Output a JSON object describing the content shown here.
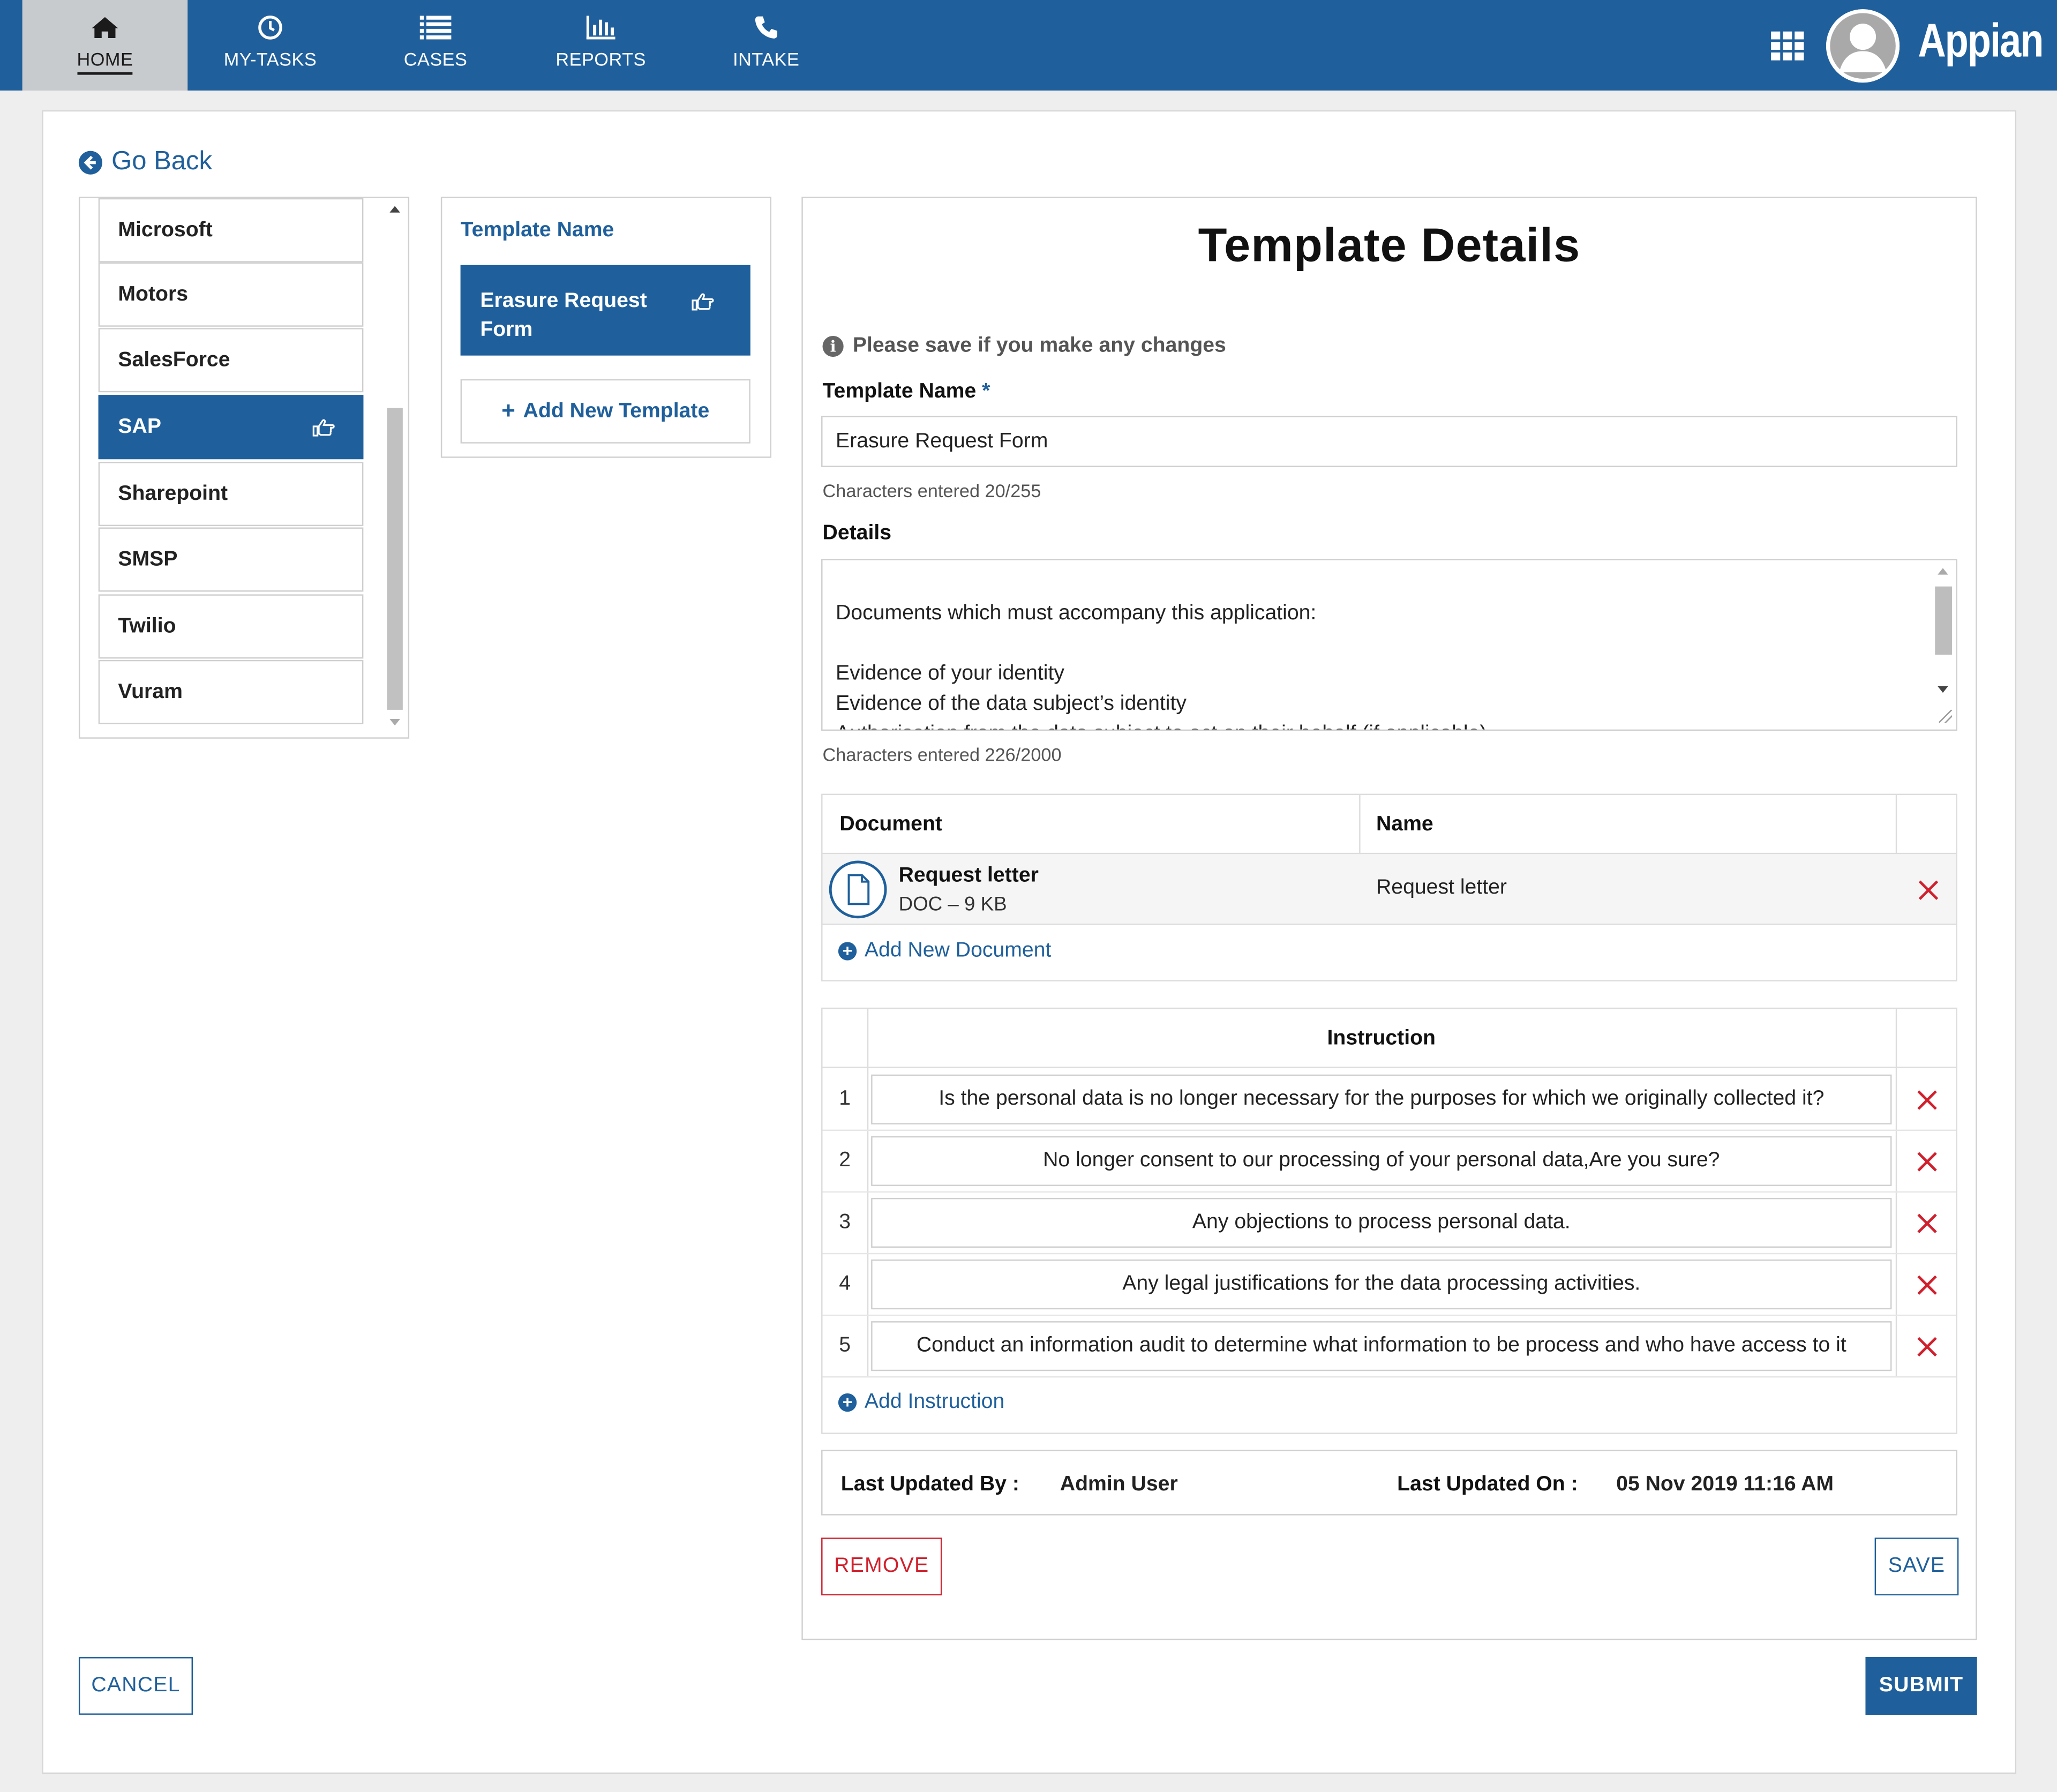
{
  "nav": {
    "items": [
      {
        "label": "HOME",
        "icon": "home-icon"
      },
      {
        "label": "MY-TASKS",
        "icon": "clock-icon"
      },
      {
        "label": "CASES",
        "icon": "list-icon"
      },
      {
        "label": "REPORTS",
        "icon": "bar-chart-icon"
      },
      {
        "label": "INTAKE",
        "icon": "phone-icon"
      }
    ],
    "logo": "Appian",
    "colors": {
      "primary": "#1f609c",
      "active_tab": "#c8cbce",
      "danger": "#d0202d"
    }
  },
  "go_back": "Go Back",
  "companies": {
    "items": [
      "Microsoft",
      "Motors",
      "SalesForce",
      "SAP",
      "Sharepoint",
      "SMSP",
      "Twilio",
      "Vuram"
    ],
    "selected": "SAP"
  },
  "templates": {
    "header": "Template Name",
    "items": [
      "Erasure Request Form"
    ],
    "add_label": "Add New Template"
  },
  "details": {
    "title": "Template Details",
    "info": "Please save if you make any changes",
    "name_label": "Template Name",
    "required_mark": "*",
    "name_value": "Erasure Request Form",
    "name_counter": "Characters entered 20/255",
    "details_label": "Details",
    "details_lines": [
      "Documents which must accompany this application:",
      "",
      "Evidence of your identity",
      "Evidence of the data subject’s identity",
      "Authorisation from the data subject to act on their behalf (if applicable)"
    ],
    "details_counter": "Characters entered 226/2000"
  },
  "documents": {
    "col_document": "Document",
    "col_name": "Name",
    "rows": [
      {
        "file_name": "Request letter",
        "meta": "DOC – 9 KB",
        "name": "Request letter"
      }
    ],
    "add_label": "Add New Document"
  },
  "instructions": {
    "header": "Instruction",
    "rows": [
      {
        "num": "1",
        "text": "Is the personal data is no longer necessary for the purposes for which we originally collected it?"
      },
      {
        "num": "2",
        "text": "No longer consent to our processing of your personal data,Are you sure?"
      },
      {
        "num": "3",
        "text": "Any objections to process personal data."
      },
      {
        "num": "4",
        "text": "Any legal justifications for the data processing activities."
      },
      {
        "num": "5",
        "text": "Conduct an information audit to determine what information to be process and who have access to it"
      }
    ],
    "add_label": "Add Instruction"
  },
  "footer": {
    "updated_by_label": "Last Updated By :",
    "updated_by": "Admin User",
    "updated_on_label": "Last Updated On :",
    "updated_on": "05 Nov 2019 11:16 AM"
  },
  "buttons": {
    "remove": "REMOVE",
    "save": "SAVE",
    "cancel": "CANCEL",
    "submit": "SUBMIT"
  }
}
